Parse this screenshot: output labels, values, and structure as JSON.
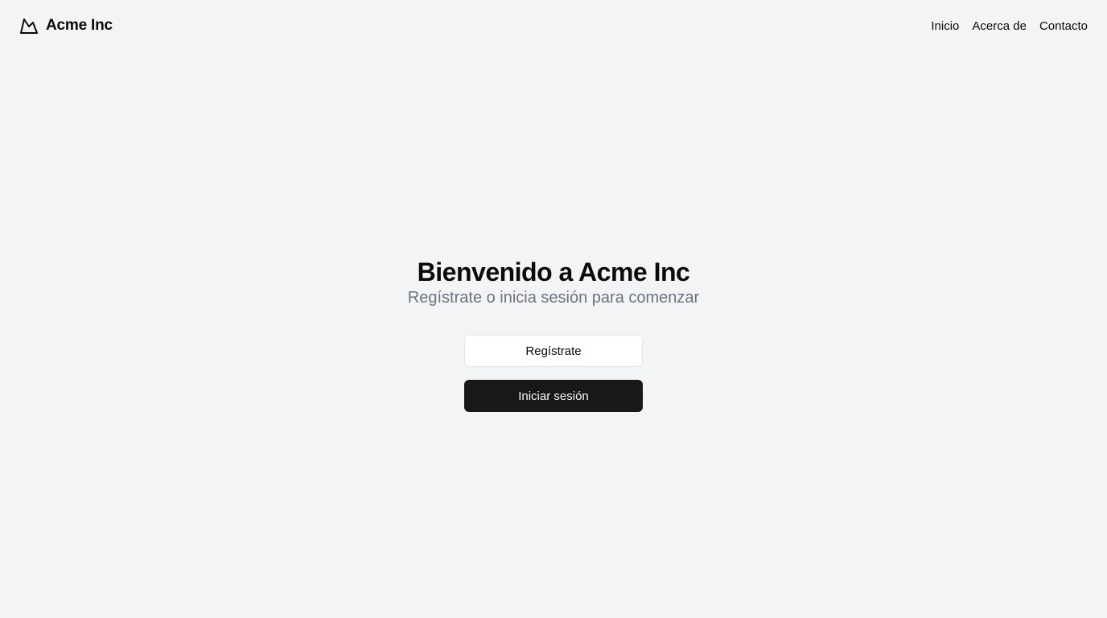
{
  "header": {
    "brand": {
      "name": "Acme Inc",
      "icon": "mountain-icon"
    },
    "nav": [
      {
        "label": "Inicio"
      },
      {
        "label": "Acerca de"
      },
      {
        "label": "Contacto"
      }
    ]
  },
  "hero": {
    "title": "Bienvenido a Acme Inc",
    "subtitle": "Regístrate o inicia sesión para comenzar"
  },
  "actions": {
    "signup_label": "Regístrate",
    "login_label": "Iniciar sesión"
  },
  "colors": {
    "background": "#f3f4f6",
    "text": "#0a0a0a",
    "muted": "#6b7280",
    "primary_button": "#18181b",
    "outline_border": "#e5e7eb"
  }
}
